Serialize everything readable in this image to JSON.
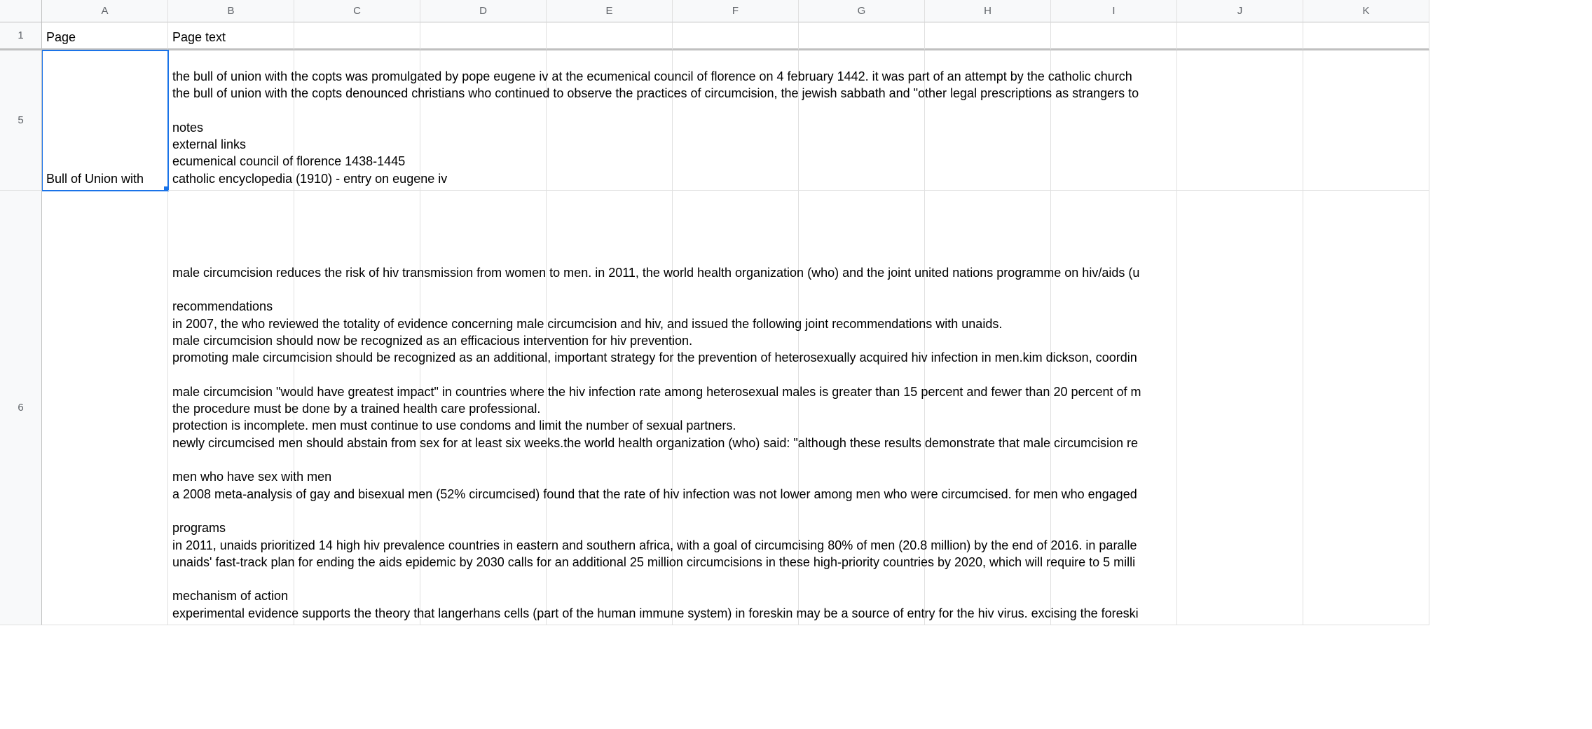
{
  "columns": [
    "A",
    "B",
    "C",
    "D",
    "E",
    "F",
    "G",
    "H",
    "I",
    "J",
    "K"
  ],
  "rows": [
    {
      "num": "1",
      "hclass": "r1 header-separator",
      "cells": {
        "A": "Page",
        "B": "Page text"
      }
    },
    {
      "num": "5",
      "hclass": "r5",
      "selectedA": true,
      "cells": {
        "A": "Bull of Union with",
        "B_overflow": "the bull of union with the copts was promulgated by pope eugene iv at the ecumenical council of florence on 4 february 1442. it was part of an attempt by the catholic church \nthe bull of union with the copts denounced christians who continued to observe the practices of circumcision, the jewish sabbath and \"other legal prescriptions as strangers to\n\nnotes\nexternal links\necumenical council of florence 1438-1445\ncatholic encyclopedia (1910) - entry on eugene iv"
      }
    },
    {
      "num": "6",
      "hclass": "r6",
      "cells": {
        "B_overflow": "male circumcision reduces the risk of hiv transmission from women to men. in 2011, the world health organization (who) and the joint united nations programme on hiv/aids (u\n\nrecommendations\nin 2007, the who reviewed the totality of evidence concerning male circumcision and hiv, and issued the following joint recommendations with unaids.\nmale circumcision should now be recognized as an efficacious intervention for hiv prevention.\npromoting male circumcision should be recognized as an additional, important strategy for the prevention of heterosexually acquired hiv infection in men.kim dickson, coordin\n\nmale circumcision \"would have greatest impact\" in countries where the hiv infection rate among heterosexual males is greater than 15 percent and fewer than 20 percent of m\nthe procedure must be done by a trained health care professional.\nprotection is incomplete. men must continue to use condoms and limit the number of sexual partners.\nnewly circumcised men should abstain from sex for at least six weeks.the world health organization (who) said: \"although these results demonstrate that male circumcision re\n\nmen who have sex with men\na 2008 meta-analysis of gay and bisexual men (52% circumcised) found that the rate of hiv infection was not lower among men who were circumcised.  for men who engaged\n\nprograms\nin 2011, unaids prioritized 14 high hiv prevalence countries in eastern and southern africa, with a goal of circumcising 80% of men (20.8 million) by the end of 2016.  in paralle\nunaids' fast-track plan for ending the aids epidemic by 2030 calls for an additional 25 million circumcisions in these high-priority countries by 2020, which will require to 5 milli\n\nmechanism of action\nexperimental evidence supports the theory that langerhans cells (part of the human immune system) in foreskin may be a source of entry for the hiv virus. excising the foreski"
      }
    }
  ]
}
